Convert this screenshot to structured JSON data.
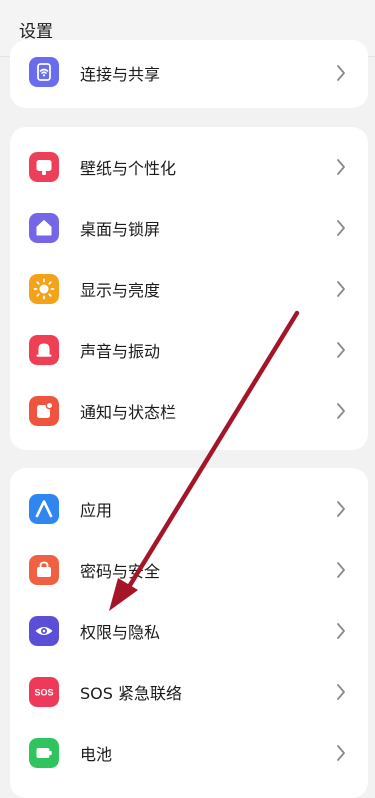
{
  "header": {
    "title": "设置"
  },
  "groups": [
    {
      "items": [
        {
          "label": "连接与共享",
          "icon": "wifi-share-icon",
          "color": "#6a6cf0"
        }
      ]
    },
    {
      "items": [
        {
          "label": "壁纸与个性化",
          "icon": "wallpaper-icon",
          "color": "#ee3f5a"
        },
        {
          "label": "桌面与锁屏",
          "icon": "home-lock-icon",
          "color": "#7566e8"
        },
        {
          "label": "显示与亮度",
          "icon": "brightness-icon",
          "color": "#f5a21b"
        },
        {
          "label": "声音与振动",
          "icon": "bell-icon",
          "color": "#ee3f55"
        },
        {
          "label": "通知与状态栏",
          "icon": "notification-icon",
          "color": "#f0533e"
        }
      ]
    },
    {
      "items": [
        {
          "label": "应用",
          "icon": "apps-icon",
          "color": "#2f86f0"
        },
        {
          "label": "密码与安全",
          "icon": "lock-bag-icon",
          "color": "#f06143"
        },
        {
          "label": "权限与隐私",
          "icon": "eye-icon",
          "color": "#5b4fd8"
        },
        {
          "label": "SOS 紧急联络",
          "icon": "sos-icon",
          "color": "#ee3a5a",
          "badge_text": "SOS"
        },
        {
          "label": "电池",
          "icon": "battery-icon",
          "color": "#30c45e"
        }
      ]
    }
  ],
  "annotation": {
    "arrow_color": "#a5152a"
  }
}
